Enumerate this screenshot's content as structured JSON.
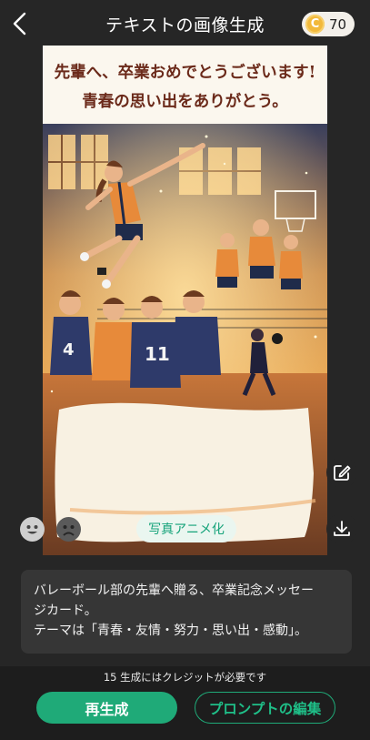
{
  "header": {
    "title": "テキストの画像生成",
    "credits": "70",
    "coin_symbol": "C"
  },
  "image": {
    "headline_line1": "先輩へ、卒業おめでとうございます!",
    "headline_line2": "青春の思い出をありがとう。",
    "jersey_number_a": "4",
    "jersey_number_b": "11"
  },
  "actions": {
    "anime_label": "写真アニメ化"
  },
  "description": {
    "line1": "バレーボール部の先輩へ贈る、卒業記念メッセー",
    "line2": "ジカード。",
    "line3": "テーマは「青春・友情・努力・思い出・感動」。"
  },
  "footer": {
    "credit_note": "15 生成にはクレジットが必要です",
    "regenerate_label": "再生成",
    "edit_prompt_label": "プロンプトの編集"
  },
  "colors": {
    "accent": "#1faa78",
    "background": "#262626",
    "coin": "#f2b93b"
  }
}
